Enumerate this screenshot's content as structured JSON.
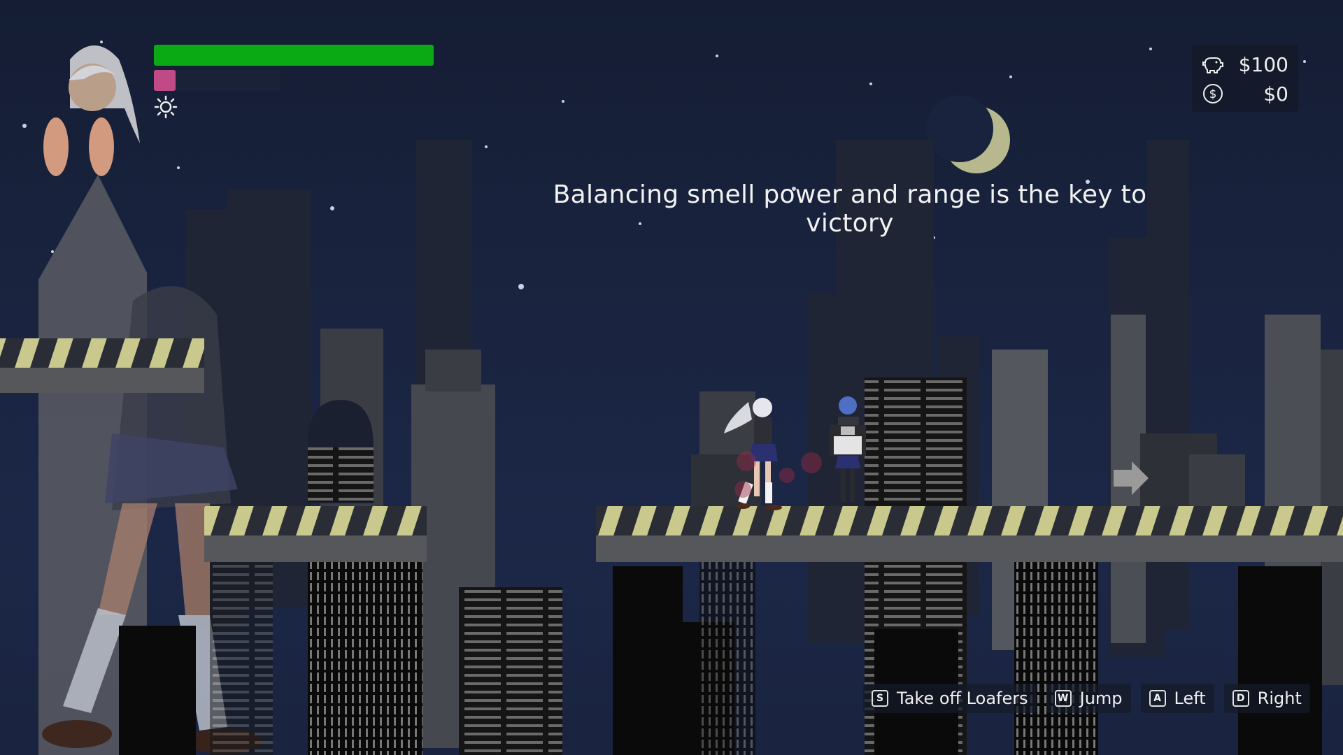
{
  "hud": {
    "health_fraction": 1.0,
    "smell_fraction": 0.17,
    "time_icon": "sun-icon",
    "colors": {
      "health": "#0aaa14",
      "smell": "#c04a86"
    }
  },
  "money": {
    "savings_icon": "piggy-bank-icon",
    "savings": "$100",
    "cash_icon": "dollar-coin-icon",
    "cash": "$0"
  },
  "hint": "Balancing smell power and range is the key to victory",
  "controls": [
    {
      "key": "S",
      "label": "Take off Loafers"
    },
    {
      "key": "W",
      "label": "Jump"
    },
    {
      "key": "A",
      "label": "Left"
    },
    {
      "key": "D",
      "label": "Right"
    }
  ],
  "scene": {
    "sky_color": "#19233e",
    "platform_stripe_color": "#c9c98e",
    "exit_icon": "arrow-right-icon"
  }
}
